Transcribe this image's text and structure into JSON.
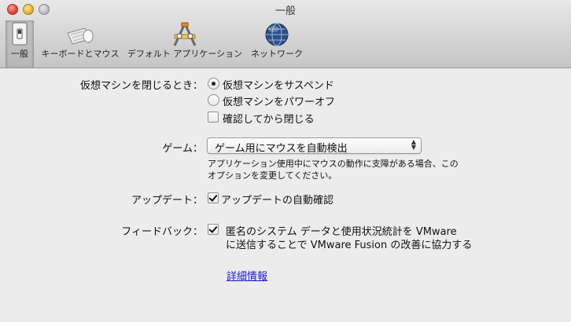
{
  "window": {
    "title": "一般"
  },
  "toolbar": {
    "items": [
      {
        "label": "一般",
        "icon": "switch-icon",
        "selected": true
      },
      {
        "label": "キーボードとマウス",
        "icon": "keyboard-mouse-icon",
        "selected": false
      },
      {
        "label": "デフォルト アプリケーション",
        "icon": "applications-icon",
        "selected": false
      },
      {
        "label": "ネットワーク",
        "icon": "network-globe-icon",
        "selected": false
      }
    ]
  },
  "close_vm": {
    "label": "仮想マシンを閉じるとき：",
    "options": [
      {
        "label": "仮想マシンをサスペンド",
        "selected": true
      },
      {
        "label": "仮想マシンをパワーオフ",
        "selected": false
      }
    ],
    "confirm": {
      "label": "確認してから閉じる",
      "checked": false
    }
  },
  "game": {
    "label": "ゲーム：",
    "selected": "ゲーム用にマウスを自動検出",
    "note_line1": "アプリケーション使用中にマウスの動作に支障がある場合、この",
    "note_line2": "オプションを変更してください。"
  },
  "update": {
    "label": "アップデート：",
    "checkbox_label": "アップデートの自動確認",
    "checked": true
  },
  "feedback": {
    "label": "フィードバック：",
    "line1": "匿名のシステム データと使用状況統計を VMware",
    "line2": "に送信することで VMware Fusion の改善に協力する",
    "checked": true
  },
  "details_link": "詳細情報"
}
